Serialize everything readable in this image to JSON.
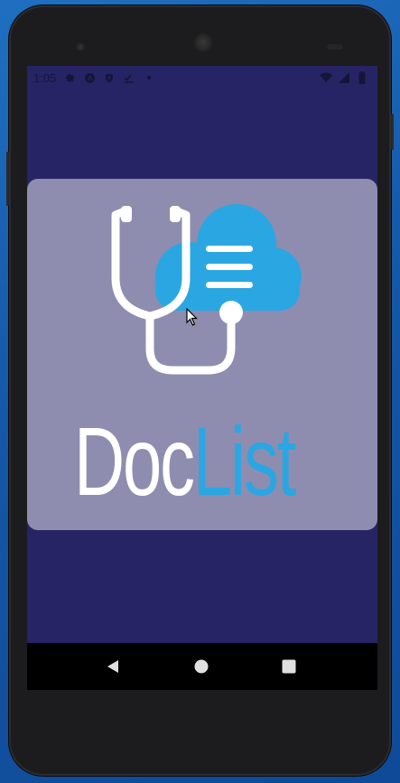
{
  "status_bar": {
    "time": "1:05",
    "icons_left": [
      "settings-gear-icon",
      "android-studio-icon",
      "shield-icon",
      "checklist-icon",
      "dot-icon"
    ],
    "icons_right": [
      "wifi-icon",
      "signal-icon",
      "battery-icon"
    ]
  },
  "splash": {
    "brand_part1": "Doc",
    "brand_part2": "List",
    "logo_icon": "stethoscope-cloud-icon",
    "colors": {
      "screen_bg": "#262464",
      "card_bg": "#8e8db0",
      "white": "#ffffff",
      "accent_blue": "#2aa7e2"
    }
  },
  "nav_bar": {
    "back_icon": "back-triangle-icon",
    "home_icon": "home-circle-icon",
    "recents_icon": "recents-square-icon"
  }
}
